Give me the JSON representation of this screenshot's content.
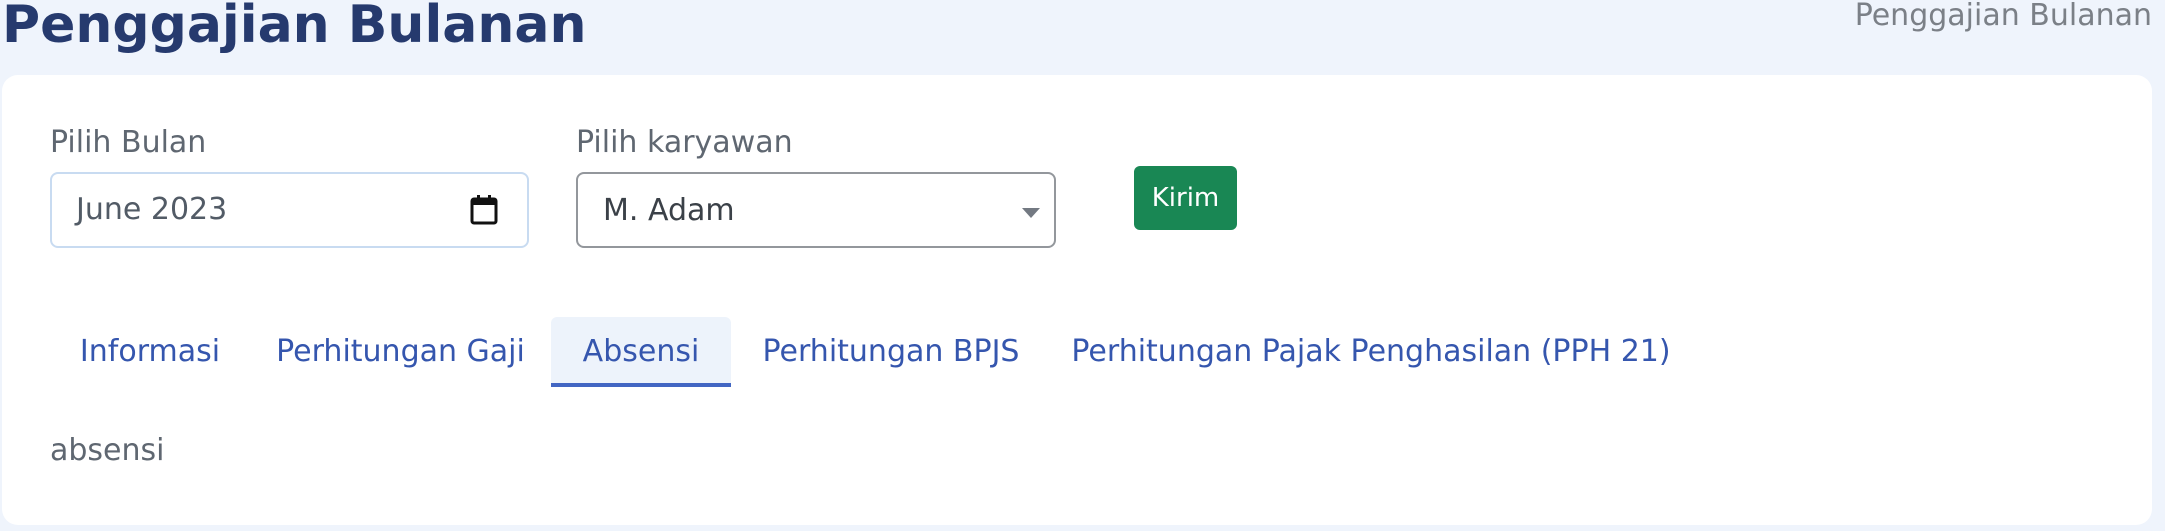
{
  "header": {
    "title": "Penggajian Bulanan",
    "breadcrumb": "Penggajian Bulanan"
  },
  "form": {
    "month_label": "Pilih Bulan",
    "month_value": "June 2023",
    "employee_label": "Pilih karyawan",
    "employee_value": "M. Adam",
    "submit_label": "Kirim"
  },
  "tabs": [
    {
      "label": "Informasi",
      "active": false
    },
    {
      "label": "Perhitungan Gaji",
      "active": false
    },
    {
      "label": "Absensi",
      "active": true
    },
    {
      "label": "Perhitungan BPJS",
      "active": false
    },
    {
      "label": "Perhitungan Pajak Penghasilan (PPH 21)",
      "active": false
    }
  ],
  "tab_content": "absensi",
  "icons": {
    "calendar": "calendar-icon",
    "select_caret": "chevron-down-icon"
  },
  "colors": {
    "background": "#eff4fc",
    "title": "#263a6e",
    "tab_text": "#3556ae",
    "active_tab_indicator": "#4266c3",
    "submit_button": "#198754"
  }
}
